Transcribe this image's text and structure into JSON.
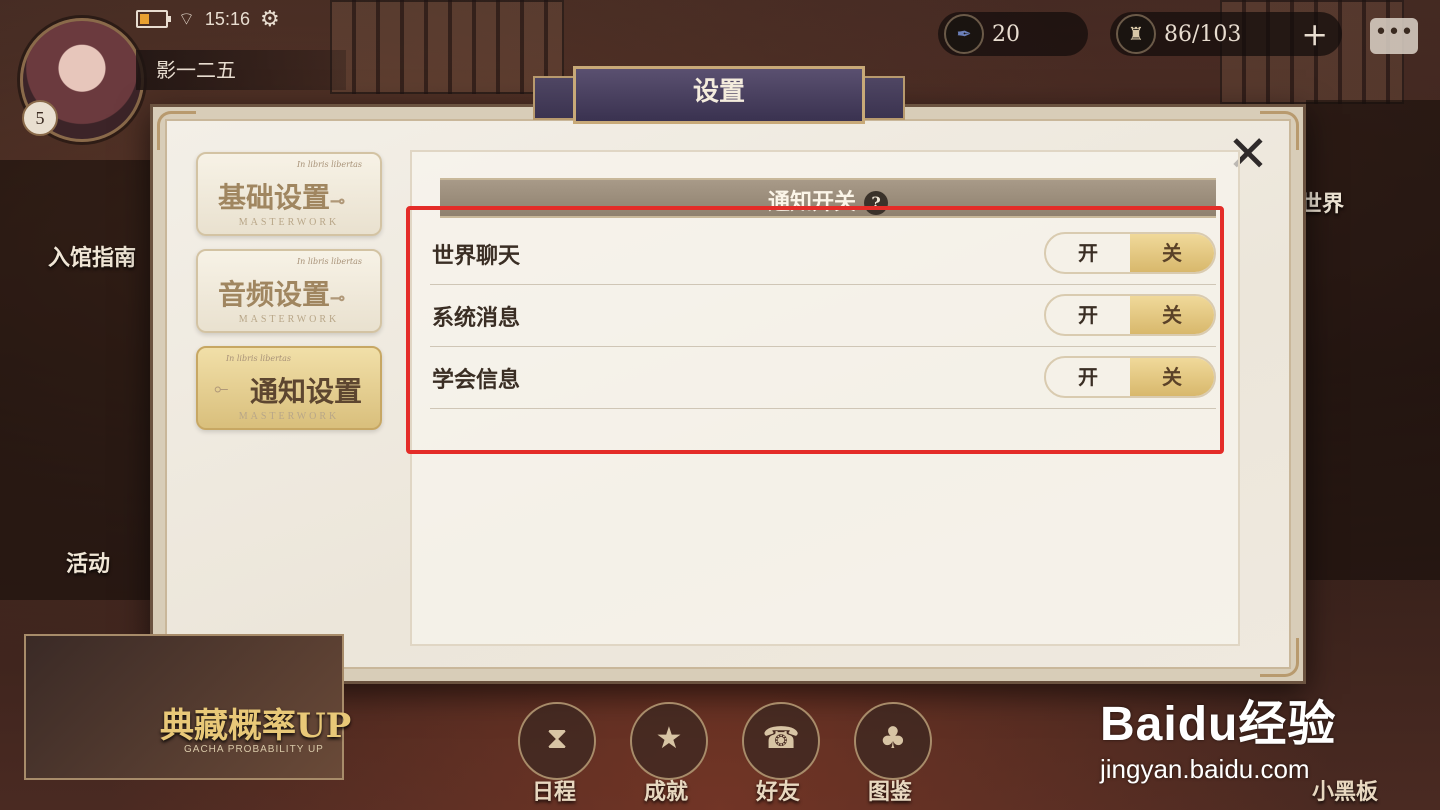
{
  "status_bar": {
    "time": "15:16"
  },
  "player": {
    "name": "影一二五",
    "level": "5"
  },
  "currencies": [
    {
      "icon": "feather-quill-icon",
      "value": "20"
    },
    {
      "icon": "candle-icon",
      "value": "86/103"
    }
  ],
  "side_menu": {
    "guide": "入馆指南",
    "activity": "活动",
    "world": "世界"
  },
  "dialog": {
    "title": "设置",
    "tabs": [
      {
        "label": "基础设置",
        "sub": "In libris libertas",
        "foot": "MASTERWORK"
      },
      {
        "label": "音频设置",
        "sub": "In libris libertas",
        "foot": "MASTERWORK"
      },
      {
        "label": "通知设置",
        "sub": "In libris libertas",
        "foot": "MASTERWORK"
      }
    ],
    "active_tab": "通知设置",
    "section_title": "通知开关",
    "help": "?",
    "rows": [
      {
        "label": "世界聊天",
        "on_label": "开",
        "off_label": "关",
        "state": "关"
      },
      {
        "label": "系统消息",
        "on_label": "开",
        "off_label": "关",
        "state": "关"
      },
      {
        "label": "学会信息",
        "on_label": "开",
        "off_label": "关",
        "state": "关"
      }
    ]
  },
  "bottom_nav": [
    {
      "label": "日程",
      "icon": "hourglass-icon"
    },
    {
      "label": "成就",
      "icon": "star-emblem-icon"
    },
    {
      "label": "好友",
      "icon": "telephone-icon"
    },
    {
      "label": "图鉴",
      "icon": "tree-icon"
    }
  ],
  "blackboard": {
    "label": "小黑板"
  },
  "promo": {
    "title": "典藏概率UP",
    "subtitle": "GACHA PROBABILITY UP"
  },
  "watermark": {
    "brand": "Baidu经验",
    "url": "jingyan.baidu.com"
  },
  "colors": {
    "highlight": "#e42c28",
    "toggle_active": "#d8b86c",
    "title_plate": "#3a3250"
  }
}
